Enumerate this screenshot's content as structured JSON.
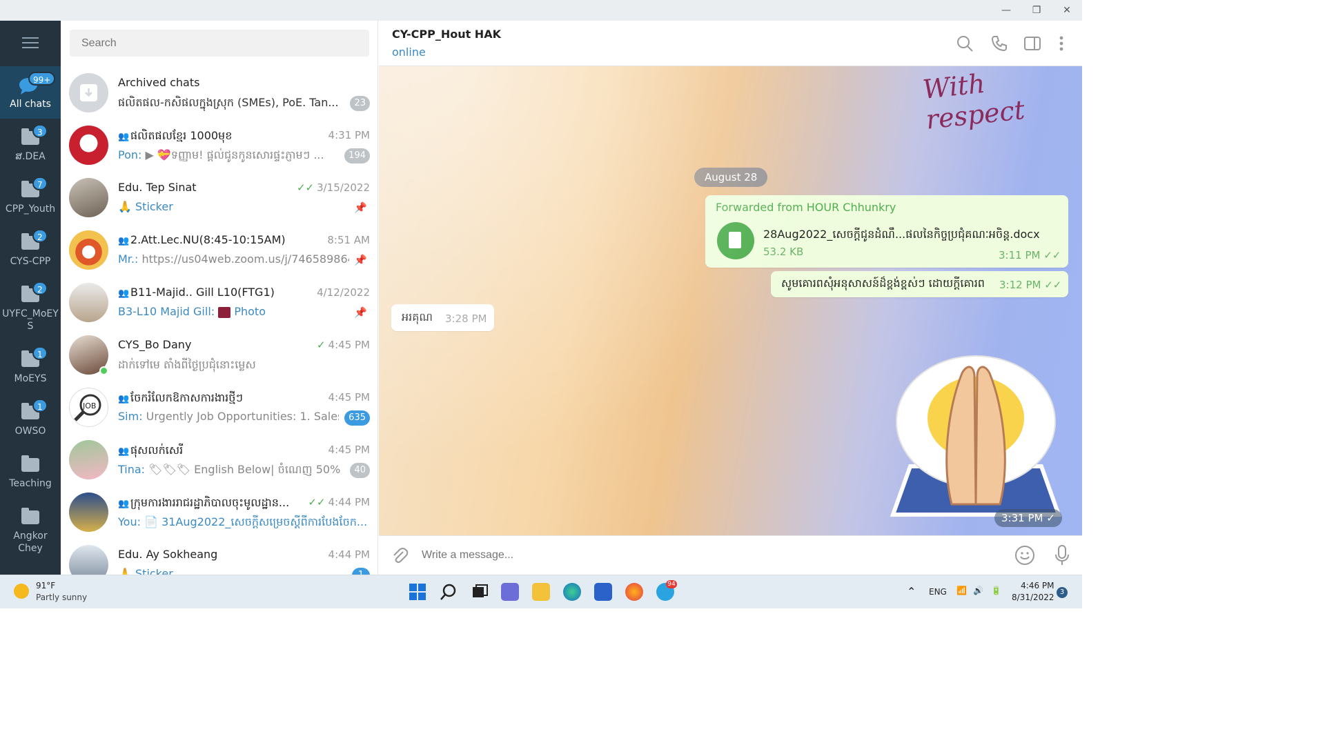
{
  "window": {
    "minimize": "—",
    "restore": "❐",
    "close": "✕"
  },
  "rail": {
    "items": [
      {
        "label": "All chats",
        "badge": "99+"
      },
      {
        "label": "ສ.DEA",
        "badge": "3"
      },
      {
        "label": "CPP_Youth",
        "badge": "7"
      },
      {
        "label": "CYS-CPP",
        "badge": "2"
      },
      {
        "label": "UYFC_MoEYS",
        "badge": "2"
      },
      {
        "label": "MoEYS",
        "badge": "1"
      },
      {
        "label": "OWSO",
        "badge": "1"
      },
      {
        "label": "Teaching",
        "badge": ""
      },
      {
        "label": "Angkor Chey",
        "badge": ""
      }
    ]
  },
  "search": {
    "placeholder": "Search"
  },
  "chats": [
    {
      "name": "Archived chats",
      "time": "",
      "sender": "",
      "preview": "ផលិតផល-កសិផលក្នុងស្រុក (SMEs), PoE. Tan...",
      "badge": "23"
    },
    {
      "name": "ផលិតផលខ្មែរ 1000មុខ",
      "time": "4:31 PM",
      "sender": "Pon:",
      "preview": "▶ 💝ទញ្ញាម! ផ្តល់ជូនកូនសោរផ្ទះភ្ញាមៗ ...",
      "badge": "194"
    },
    {
      "name": "Edu. Tep Sinat",
      "time": "3/15/2022",
      "sender": "🙏 Sticker",
      "preview": "",
      "badge": ""
    },
    {
      "name": "2.Att.Lec.NU(8:45-10:15AM)",
      "time": "8:51 AM",
      "sender": "Mr.:",
      "preview": "https://us04web.zoom.us/j/746589864...",
      "badge": ""
    },
    {
      "name": "B11-Majid.. Gill L10(FTG1)",
      "time": "4/12/2022",
      "sender": "B3-L10 Majid Gill:",
      "preview": "Photo",
      "badge": ""
    },
    {
      "name": "CYS_Bo Dany",
      "time": "4:45 PM",
      "sender": "",
      "preview": "ដាក់ទៅមេ តាំងពីថ្ងៃប្រជុំនោះម្លេស",
      "badge": ""
    },
    {
      "name": "ចែករំលែកឱកាសការងារថ្មីៗ",
      "time": "4:45 PM",
      "sender": "Sim:",
      "preview": "Urgently Job Opportunities:  1. Sales ...",
      "badge": "635"
    },
    {
      "name": "ផុសលក់សេរី",
      "time": "4:45 PM",
      "sender": "Tina:",
      "preview": "🏷🏷🏷 English Below| ចំណេញ 50% ...",
      "badge": "40"
    },
    {
      "name": "ក្រុមការងាររាជរដ្ឋាភិបាលចុះមូលដ្ឋាន...",
      "time": "4:44 PM",
      "sender": "You:",
      "preview": "📄 31Aug2022_សេចក្តីសម្រេចស្តីពីការបែងចែក...",
      "badge": ""
    },
    {
      "name": "Edu. Ay Sokheang",
      "time": "4:44 PM",
      "sender": "🙏 Sticker",
      "preview": "",
      "badge": "1"
    }
  ],
  "chat": {
    "title": "CY-CPP_Hout HAK",
    "status": "online",
    "sticker_text": "With respect",
    "date_label": "August 28",
    "messages": {
      "forwarded_from": "Forwarded from HOUR Chhunkry",
      "doc_name": "28Aug2022_សេចក្តីជូនដំណឹ...ផលនៃកិច្ចប្រជុំគណៈអចិន្ត.docx",
      "doc_size": "53.2 KB",
      "doc_time": "3:11 PM",
      "text_out": "សូមគោរពសុំអនុសាសន៍ដ៏ខ្ពង់ខ្ពស់ៗ ដោយក្តីគោរព",
      "text_out_time": "3:12 PM",
      "text_in": "អរគុណ",
      "text_in_time": "3:28 PM",
      "sticker_time": "3:31 PM"
    }
  },
  "composer": {
    "placeholder": "Write a message..."
  },
  "taskbar": {
    "weather_temp": "91°F",
    "weather_desc": "Partly sunny",
    "lang": "ENG",
    "time": "4:46 PM",
    "date": "8/31/2022",
    "notifications": "3",
    "telegram_badge": "94"
  },
  "colors": {
    "accent": "#3a8ac4",
    "green": "#4fae4e",
    "rail": "#25333f"
  }
}
